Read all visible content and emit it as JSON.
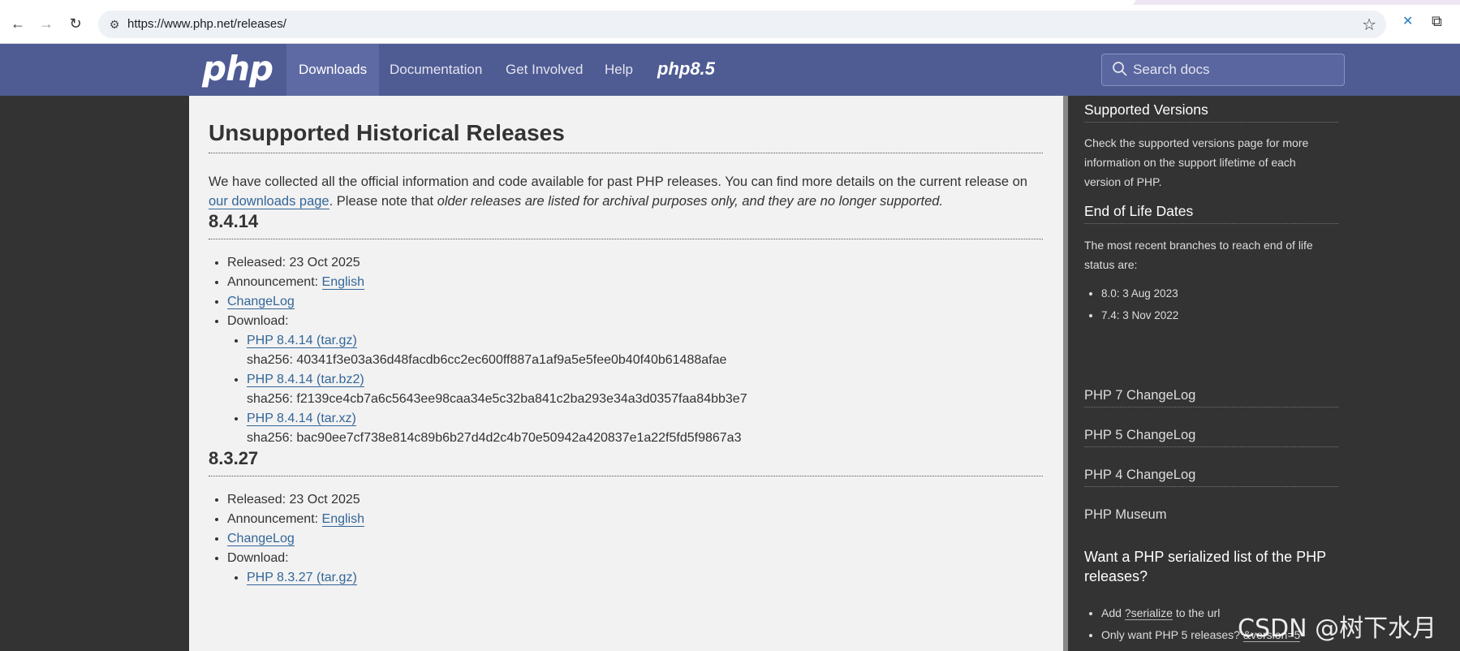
{
  "browser": {
    "url": "https://www.php.net/releases/",
    "back_icon": "←",
    "forward_icon": "→",
    "reload_icon": "↻",
    "bookmark_icon": "☆",
    "extension_icon": "✕",
    "puzzle_icon": "⧉"
  },
  "navbar": {
    "logo": "php",
    "items": [
      "Downloads",
      "Documentation",
      "Get Involved",
      "Help"
    ],
    "active_item": "Downloads",
    "php85_label": "php8.5",
    "search_placeholder": "Search docs"
  },
  "main": {
    "title": "Unsupported Historical Releases",
    "intro_text_1": "We have collected all the official information and code available for past PHP releases. You can find more details on the current release on ",
    "intro_link": "our downloads page",
    "intro_text_2": ". Please note that ",
    "intro_emphasis": "older releases are listed for archival purposes only, and they are no longer supported.",
    "releases": [
      {
        "version": "8.4.14",
        "released_label": "Released:",
        "released": "23 Oct 2025",
        "announcement_label": "Announcement:",
        "announcement_link": "English",
        "changelog": "ChangeLog",
        "download_label": "Download:",
        "downloads": [
          {
            "label": "PHP 8.4.14 (tar.gz)",
            "sha": "sha256: 40341f3e03a36d48facdb6cc2ec600ff887a1af9a5e5fee0b40f40b61488afae"
          },
          {
            "label": "PHP 8.4.14 (tar.bz2)",
            "sha": "sha256: f2139ce4cb7a6c5643ee98caa34e5c32ba841c2ba293e34a3d0357faa84bb3e7"
          },
          {
            "label": "PHP 8.4.14 (tar.xz)",
            "sha": "sha256: bac90ee7cf738e814c89b6b27d4d2c4b70e50942a420837e1a22f5fd5f9867a3"
          }
        ]
      },
      {
        "version": "8.3.27",
        "released_label": "Released:",
        "released": "23 Oct 2025",
        "announcement_label": "Announcement:",
        "announcement_link": "English",
        "changelog": "ChangeLog",
        "download_label": "Download:",
        "downloads": [
          {
            "label": "PHP 8.3.27 (tar.gz)"
          }
        ]
      }
    ]
  },
  "sidebar": {
    "supported_title": "Supported Versions",
    "supported_text": "Check the supported versions page for more information on the support lifetime of each version of PHP.",
    "eol_title": "End of Life Dates",
    "eol_text": "The most recent branches to reach end of life status are:",
    "eol_items": [
      "8.0: 3 Aug 2023",
      "7.4: 3 Nov 2022"
    ],
    "links": [
      "PHP 7 ChangeLog",
      "PHP 5 ChangeLog",
      "PHP 4 ChangeLog",
      "PHP Museum"
    ],
    "serialized_title": "Want a PHP serialized list of the PHP releases?",
    "serialized_item_1_pre": "Add ",
    "serialized_item_1_code": "?serialize",
    "serialized_item_1_post": " to the url",
    "serialized_item_2_pre": "Only want PHP 5 releases? ",
    "serialized_item_2_code": "&version=5"
  },
  "watermark": "CSDN @树下水月"
}
